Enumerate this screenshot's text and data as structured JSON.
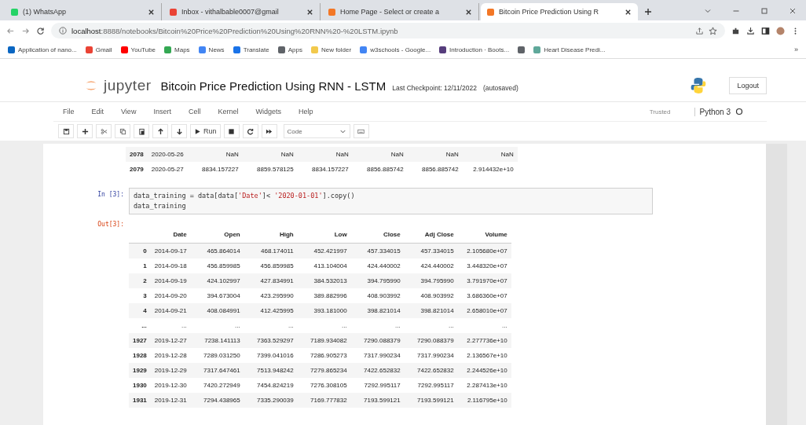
{
  "browser": {
    "tabs": [
      {
        "title": "(1) WhatsApp",
        "kind": "chat",
        "selected": false
      },
      {
        "title": "Inbox - vithalbable0007@gmail",
        "kind": "mail",
        "selected": false
      },
      {
        "title": "Home Page - Select or create a",
        "kind": "home",
        "selected": false
      },
      {
        "title": "Bitcoin Price Prediction Using R",
        "kind": "notebook",
        "selected": true
      }
    ],
    "url_host": "localhost",
    "url_rest": ":8888/notebooks/Bitcoin%20Price%20Prediction%20Using%20RNN%20-%20LSTM.ipynb",
    "bookmarks": [
      {
        "label": "Application of nano...",
        "color": "#0a66c2"
      },
      {
        "label": "Gmail",
        "color": "#ea4335"
      },
      {
        "label": "YouTube",
        "color": "#ff0000"
      },
      {
        "label": "Maps",
        "color": "#34a853"
      },
      {
        "label": "News",
        "color": "#4285f4"
      },
      {
        "label": "Translate",
        "color": "#1a73e8"
      },
      {
        "label": "Apps",
        "color": "#5f6368"
      },
      {
        "label": "New folder",
        "color": "#f2c94c"
      },
      {
        "label": "w3schools - Google...",
        "color": "#4285f4"
      },
      {
        "label": "Introduction · Boots...",
        "color": "#563d7c"
      },
      {
        "color": "#5f6368"
      },
      {
        "label": "Heart Disease Predi...",
        "color": "#5fa89a"
      }
    ],
    "more": "»"
  },
  "jupyter": {
    "logo_text": "jupyter",
    "title": "Bitcoin Price Prediction Using RNN - LSTM",
    "checkpoint": "Last Checkpoint: 12/11/2022",
    "autosave": "(autosaved)",
    "logout": "Logout",
    "menu": [
      "File",
      "Edit",
      "View",
      "Insert",
      "Cell",
      "Kernel",
      "Widgets",
      "Help"
    ],
    "trusted": "Trusted",
    "kernel": "Python 3",
    "run": "Run",
    "cell_type": "Code"
  },
  "notebook": {
    "prev_rows": [
      [
        "2078",
        "2020-05-26",
        "NaN",
        "NaN",
        "NaN",
        "NaN",
        "NaN",
        "NaN"
      ],
      [
        "2079",
        "2020-05-27",
        "8834.157227",
        "8859.578125",
        "8834.157227",
        "8856.885742",
        "8856.885742",
        "2.914432e+10"
      ]
    ],
    "in_prompt": "In [3]:",
    "code": [
      [
        {
          "text": "data_training = data[data[",
          "kind": "plain"
        },
        {
          "text": "'Date'",
          "kind": "string"
        },
        {
          "text": "]< ",
          "kind": "plain"
        },
        {
          "text": "'2020-01-01'",
          "kind": "string"
        },
        {
          "text": "].copy()",
          "kind": "plain"
        }
      ],
      [
        {
          "text": "data_training",
          "kind": "plain"
        }
      ]
    ],
    "out_prompt": "Out[3]:",
    "columns": [
      "",
      "Date",
      "Open",
      "High",
      "Low",
      "Close",
      "Adj Close",
      "Volume"
    ],
    "rows": [
      [
        "0",
        "2014-09-17",
        "465.864014",
        "468.174011",
        "452.421997",
        "457.334015",
        "457.334015",
        "2.105680e+07"
      ],
      [
        "1",
        "2014-09-18",
        "456.859985",
        "456.859985",
        "413.104004",
        "424.440002",
        "424.440002",
        "3.448320e+07"
      ],
      [
        "2",
        "2014-09-19",
        "424.102997",
        "427.834991",
        "384.532013",
        "394.795990",
        "394.795990",
        "3.791970e+07"
      ],
      [
        "3",
        "2014-09-20",
        "394.673004",
        "423.295990",
        "389.882996",
        "408.903992",
        "408.903992",
        "3.686360e+07"
      ],
      [
        "4",
        "2014-09-21",
        "408.084991",
        "412.425995",
        "393.181000",
        "398.821014",
        "398.821014",
        "2.658010e+07"
      ],
      [
        "...",
        "...",
        "...",
        "...",
        "...",
        "...",
        "...",
        "..."
      ],
      [
        "1927",
        "2019-12-27",
        "7238.141113",
        "7363.529297",
        "7189.934082",
        "7290.088379",
        "7290.088379",
        "2.277736e+10"
      ],
      [
        "1928",
        "2019-12-28",
        "7289.031250",
        "7399.041016",
        "7286.905273",
        "7317.990234",
        "7317.990234",
        "2.136567e+10"
      ],
      [
        "1929",
        "2019-12-29",
        "7317.647461",
        "7513.948242",
        "7279.865234",
        "7422.652832",
        "7422.652832",
        "2.244526e+10"
      ],
      [
        "1930",
        "2019-12-30",
        "7420.272949",
        "7454.824219",
        "7276.308105",
        "7292.995117",
        "7292.995117",
        "2.287413e+10"
      ],
      [
        "1931",
        "2019-12-31",
        "7294.438965",
        "7335.290039",
        "7169.777832",
        "7193.599121",
        "7193.599121",
        "2.116795e+10"
      ]
    ]
  }
}
